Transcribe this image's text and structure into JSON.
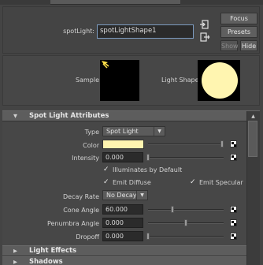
{
  "header": {
    "node_label": "spotLight:",
    "node_value": "spotLightShape1",
    "focus_label": "Focus",
    "presets_label": "Presets",
    "show_label": "Show",
    "hide_label": "Hide"
  },
  "swatches": {
    "sample_label": "Sample",
    "light_shape_label": "Light Shape",
    "light_color": "#fff5b0"
  },
  "spot_light_attributes": {
    "section_title": "Spot Light Attributes",
    "type_label": "Type",
    "type_value": "Spot Light",
    "color_label": "Color",
    "color_value": "#fff5b0",
    "intensity_label": "Intensity",
    "intensity_value": "0.000",
    "illuminates_label": "Illuminates by Default",
    "illuminates_checked": true,
    "emit_diffuse_label": "Emit Diffuse",
    "emit_diffuse_checked": true,
    "emit_specular_label": "Emit Specular",
    "emit_specular_checked": true,
    "decay_rate_label": "Decay Rate",
    "decay_rate_value": "No Decay",
    "cone_angle_label": "Cone Angle",
    "cone_angle_value": "60.000",
    "penumbra_angle_label": "Penumbra Angle",
    "penumbra_angle_value": "0.000",
    "dropoff_label": "Dropoff",
    "dropoff_value": "0.000"
  },
  "sections": {
    "light_effects": "Light Effects",
    "shadows": "Shadows"
  },
  "icons": {
    "sample_swatch_icon": "light-bulb-icon",
    "node_buttons": [
      "input-connections-icon",
      "output-connections-icon"
    ],
    "checkmark": "✓"
  }
}
